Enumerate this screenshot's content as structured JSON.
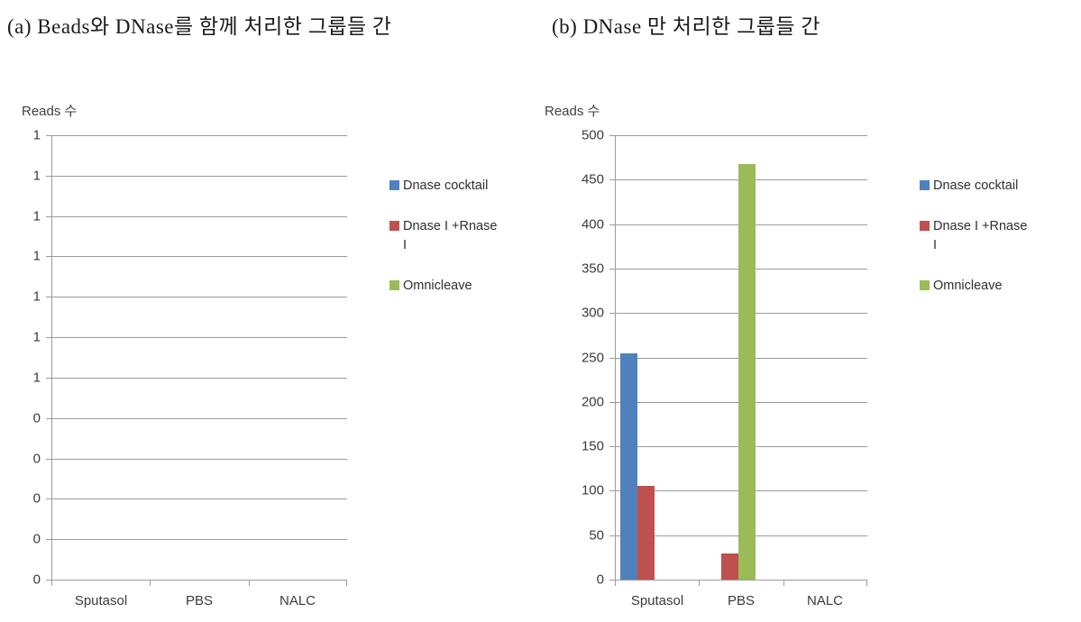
{
  "captions": {
    "a": "(a) Beads와 DNase를 함께 처리한 그룹들 간",
    "b": "(b) DNase 만 처리한 그룹들 간"
  },
  "colors": {
    "series_1": "#4E81BD",
    "series_2": "#C0504D",
    "series_3": "#9BBB59",
    "gridline": "#9C9C9C",
    "tick_label": "#3B3B3B",
    "caption_text": "#1A1A1A"
  },
  "chart_data": [
    {
      "id": "chart-a",
      "type": "bar",
      "title": "(a) Beads와 DNase를 함께 처리한 그룹들 간",
      "ylabel": "Reads 수",
      "xlabel": "",
      "categories": [
        "Sputasol",
        "PBS",
        "NALC"
      ],
      "series": [
        {
          "name": "Dnase cocktail",
          "color": "#4E81BD",
          "values": [
            0,
            0,
            0
          ]
        },
        {
          "name": "Dnase I +Rnase I",
          "color": "#C0504D",
          "values": [
            0,
            0,
            0
          ]
        },
        {
          "name": "Omnicleave",
          "color": "#9BBB59",
          "values": [
            0,
            0,
            0
          ]
        }
      ],
      "ylim": [
        0,
        1
      ],
      "ytick_labels": [
        "1",
        "1",
        "1",
        "1",
        "1",
        "1",
        "1",
        "0",
        "0",
        "0",
        "0",
        "0"
      ],
      "grid": true,
      "legend_position": "right",
      "legend": [
        "Dnase cocktail",
        "Dnase I +Rnase I",
        "Omnicleave"
      ]
    },
    {
      "id": "chart-b",
      "type": "bar",
      "title": "(b) DNase 만 처리한 그룹들 간",
      "ylabel": "Reads 수",
      "xlabel": "",
      "categories": [
        "Sputasol",
        "PBS",
        "NALC"
      ],
      "series": [
        {
          "name": "Dnase cocktail",
          "color": "#4E81BD",
          "values": [
            255,
            0,
            0
          ]
        },
        {
          "name": "Dnase I +Rnase I",
          "color": "#C0504D",
          "values": [
            105,
            29,
            0
          ]
        },
        {
          "name": "Omnicleave",
          "color": "#9BBB59",
          "values": [
            0,
            468,
            0
          ]
        }
      ],
      "ylim": [
        0,
        500
      ],
      "ytick_labels": [
        "500",
        "450",
        "400",
        "350",
        "300",
        "250",
        "200",
        "150",
        "100",
        "50",
        "0"
      ],
      "grid": true,
      "legend_position": "right",
      "legend": [
        "Dnase cocktail",
        "Dnase I +Rnase I",
        "Omnicleave"
      ]
    }
  ],
  "legend_entries": [
    {
      "label": "Dnase cocktail",
      "label_line2": "",
      "color": "#4E81BD"
    },
    {
      "label": "Dnase I +Rnase",
      "label_line2": "I",
      "color": "#C0504D"
    },
    {
      "label": "Omnicleave",
      "label_line2": "",
      "color": "#9BBB59"
    }
  ]
}
